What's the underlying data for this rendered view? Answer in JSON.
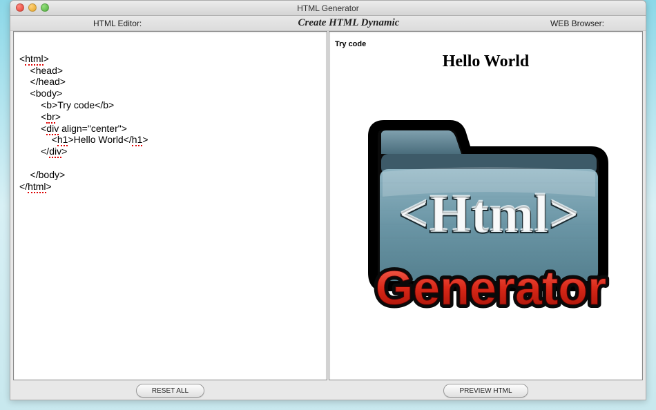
{
  "window": {
    "title": "HTML Generator"
  },
  "headers": {
    "left": "HTML Editor:",
    "center": "Create HTML Dynamic",
    "right": "WEB Browser:"
  },
  "editor": {
    "lines": [
      "<html>",
      "    <head>",
      "    </head>",
      "    <body>",
      "        <b>Try code</b>",
      "        <br>",
      "        <div align=\"center\">",
      "            <h1>Hello World</h1>",
      "        </div>",
      "",
      "    </body>",
      "</html>"
    ]
  },
  "preview": {
    "bold_text": "Try code",
    "heading": "Hello World",
    "logo_top": "<Html>",
    "logo_bottom": "Generator"
  },
  "buttons": {
    "reset": "RESET ALL",
    "preview": "PREVIEW HTML"
  }
}
